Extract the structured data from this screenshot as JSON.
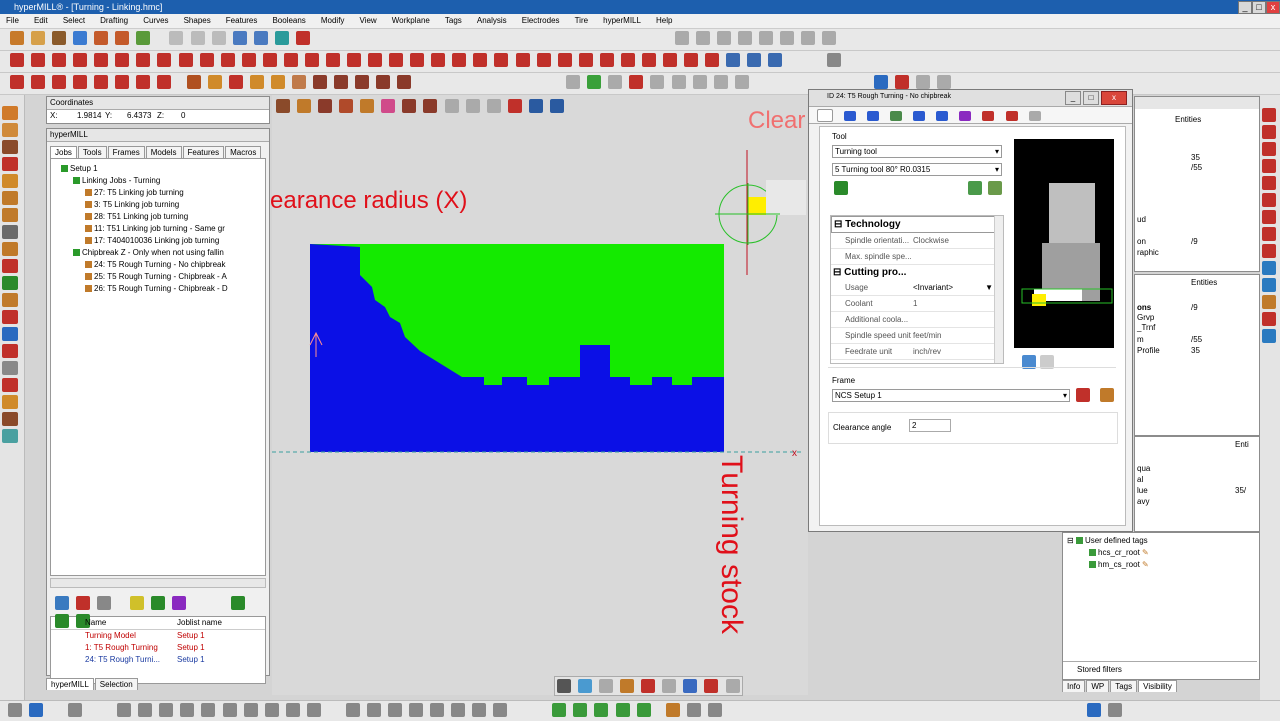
{
  "window": {
    "title": "hyperMILL® - [Turning - Linking.hmc]"
  },
  "menu": [
    "File",
    "Edit",
    "Select",
    "Drafting",
    "Curves",
    "Shapes",
    "Features",
    "Booleans",
    "Modify",
    "View",
    "Workplane",
    "Tags",
    "Analysis",
    "Electrodes",
    "Tire",
    "hyperMILL",
    "Help"
  ],
  "coords": {
    "title": "Coordinates",
    "x_label": "X:",
    "x": "1.9814",
    "y_label": "Y:",
    "y": "6.4373",
    "z_label": "Z:",
    "z": "0"
  },
  "hypermill_panel": {
    "title": "hyperMILL",
    "tabs": [
      "Jobs",
      "Tools",
      "Frames",
      "Models",
      "Features",
      "Macros"
    ],
    "tree": [
      {
        "label": "Setup 1",
        "level": 0
      },
      {
        "label": "Linking Jobs - Turning",
        "level": 1
      },
      {
        "label": "27: T5 Linking job turning",
        "level": 2
      },
      {
        "label": "3: T5 Linking job turning",
        "level": 2
      },
      {
        "label": "28: T51 Linking job turning",
        "level": 2
      },
      {
        "label": "11: T51 Linking job turning - Same gr",
        "level": 2
      },
      {
        "label": "17: T404010036 Linking job turning",
        "level": 2
      },
      {
        "label": "Chipbreak Z - Only when not using fallin",
        "level": 1
      },
      {
        "label": "24: T5 Rough Turning - No chipbreak",
        "level": 2
      },
      {
        "label": "25: T5 Rough Turning - Chipbreak - A",
        "level": 2
      },
      {
        "label": "26: T5 Rough Turning - Chipbreak - D",
        "level": 2
      }
    ],
    "list_headers": [
      "Name",
      "Joblist name"
    ],
    "list_rows": [
      {
        "name": "Turning Model",
        "joblist": "Setup 1"
      },
      {
        "name": "1: T5 Rough Turning",
        "joblist": "Setup 1"
      },
      {
        "name": "24: T5 Rough Turni...",
        "joblist": "Setup 1"
      }
    ],
    "bottom_tabs": [
      "hyperMILL",
      "Selection"
    ]
  },
  "viewport": {
    "label_clearance": "earance radius (X)",
    "label_clear_top": "Clear",
    "label_turning_stock": "Turning stock"
  },
  "dialog": {
    "title": "ID 24: T5 Rough Turning - No chipbreak",
    "tool_group": "Tool",
    "tool_type": "Turning tool",
    "tool_value": "5  Turning tool  80° R0.0315",
    "technology_header": "Technology",
    "tech_rows": [
      {
        "k": "Spindle orientati...",
        "v": "Clockwise"
      },
      {
        "k": "Max. spindle spe...",
        "v": ""
      }
    ],
    "cutting_header": "Cutting pro...",
    "cut_rows": [
      {
        "k": "Usage",
        "v": "<Invariant>"
      },
      {
        "k": "Coolant",
        "v": "1"
      },
      {
        "k": "Additional coola...",
        "v": ""
      },
      {
        "k": "Spindle speed unit",
        "v": "feet/min"
      },
      {
        "k": "Feedrate unit",
        "v": "inch/rev"
      }
    ],
    "frame_group": "Frame",
    "frame_value": "NCS Setup 1",
    "clearance_label": "Clearance angle",
    "clearance_value": "2"
  },
  "right_panel": {
    "entities_header": "Entities",
    "entities_values": [
      "35",
      "/55",
      "/9"
    ],
    "fragment_labels": [
      "ud",
      "on",
      "raphic"
    ],
    "entities_header2": "Entities",
    "list2": [
      {
        "k": "ons",
        "v": "/9"
      },
      {
        "k": "Grvp",
        "v": ""
      },
      {
        "k": "_Trnf",
        "v": ""
      },
      {
        "k": "m",
        "v": "/55"
      },
      {
        "k": "Profile",
        "v": "35"
      }
    ],
    "enti_label": "Enti",
    "fragment3": [
      "qua",
      "al",
      "lue",
      "avy"
    ],
    "fragment3_value": "35/",
    "tags_root": "User defined tags",
    "tags": [
      "hcs_cr_root",
      "hm_cs_root"
    ],
    "stored_filters": "Stored filters",
    "bottom_tabs": [
      "Info",
      "WP",
      "Tags",
      "Visibility"
    ]
  },
  "colors": {
    "stock_blue": "#0b10e6",
    "model_green": "#14ea00",
    "annotation_red": "#e0101a"
  }
}
